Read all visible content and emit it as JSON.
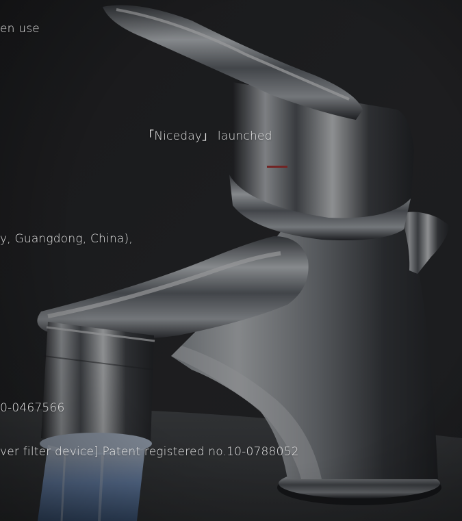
{
  "text_lines": [
    "en use",
    "「Niceday」 launched",
    "y, Guangdong, China),",
    "0-0467566",
    "ver filter device] Patent registered no.10-0788052"
  ],
  "colors": {
    "background": "#2b2c2f",
    "text": "#e6e6e6",
    "chrome_dark": "#3a3c40",
    "chrome_light": "#cfd3d8",
    "water_blue": "#bcd6ff"
  }
}
